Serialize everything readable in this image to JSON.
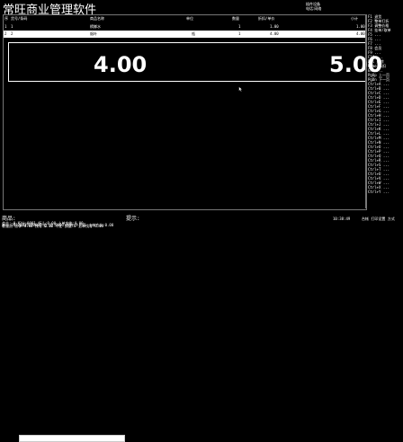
{
  "app_title": "常旺商业管理软件",
  "top_right": {
    "line1": "插件设备",
    "line2": "电话:网络"
  },
  "grid": {
    "columns": [
      "序",
      "货号/条码",
      "商品名称",
      "单位",
      "数量",
      "折扣/单价",
      "小计"
    ],
    "rows": [
      {
        "idx": "1",
        "code": "1",
        "name": "槟榔水",
        "unit": "",
        "qty": "1",
        "price": "1.00",
        "subtotal": "1.00"
      },
      {
        "idx": "2",
        "code": "2",
        "name": "烟叶",
        "unit": "瓶",
        "qty": "1",
        "price": "4.00",
        "subtotal": "4.00"
      }
    ]
  },
  "big_display": {
    "left": "4.00",
    "right": "5.00"
  },
  "side_menu": [
    "F1 退货",
    "F2 整单打折",
    "F3 调整价格",
    "F4 挂单/取单",
    "F5 ...",
    "F6 ...",
    "F7 ...",
    "F8 会员",
    "F9 ...",
    "F10 ...",
    "Del 删除",
    "Home 折扣",
    "End ...",
    "PgUp 上一页",
    "PgDn 下一页",
    "Ctrl+A ...",
    "Ctrl+B ...",
    "Ctrl+C ...",
    "Ctrl+D ...",
    "Ctrl+E ...",
    "Ctrl+F ...",
    "Ctrl+G ...",
    "Ctrl+H ...",
    "Ctrl+I ...",
    "Ctrl+J ...",
    "Ctrl+K ...",
    "Ctrl+L ...",
    "Ctrl+M ...",
    "Ctrl+N ...",
    "Ctrl+O ...",
    "Ctrl+P ...",
    "Ctrl+Q ...",
    "Ctrl+R ...",
    "Ctrl+S ...",
    "Ctrl+T ...",
    "Ctrl+U ...",
    "Ctrl+V ...",
    "Ctrl+W ...",
    "Ctrl+X ...",
    "Ctrl+Y ..."
  ],
  "bottom": {
    "search_label": "商品:",
    "prompt_label": "提示:",
    "time": "10:38:49",
    "right_label": "台帐 打印设置 方式",
    "line1": "单号:20120815130007   会 员:0001   币种:人民币 上单合计:0.00",
    "line2": "会个: 0         积分:0001          折让:0.00   上单实收:0.00",
    "line3": "收银员   总体:0.00      找零:0.00 不定  数量:0  上单找零:0.00"
  }
}
